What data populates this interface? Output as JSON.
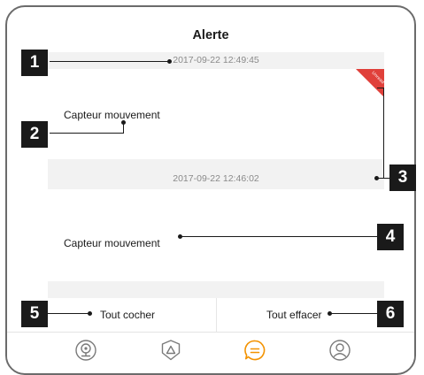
{
  "header": {
    "title": "Alerte"
  },
  "alerts": [
    {
      "timestamp": "2017-09-22 12:49:45",
      "label": "Capteur mouvement",
      "unread_tag": "Unread"
    },
    {
      "timestamp": "2017-09-22 12:46:02",
      "label": "Capteur mouvement"
    }
  ],
  "actions": {
    "select_all": "Tout cocher",
    "clear_all": "Tout effacer"
  },
  "tabbar": {
    "items": [
      {
        "icon": "camera-icon",
        "active": false
      },
      {
        "icon": "shield-alert-icon",
        "active": false
      },
      {
        "icon": "message-icon",
        "active": true
      },
      {
        "icon": "user-icon",
        "active": false
      }
    ],
    "active_color": "#f39200",
    "inactive_color": "#7a7a7a"
  },
  "callouts": [
    "1",
    "2",
    "3",
    "4",
    "5",
    "6"
  ],
  "colors": {
    "tag": "#e0403a",
    "strip": "#f2f2f2",
    "callout": "#1a1a1a"
  }
}
